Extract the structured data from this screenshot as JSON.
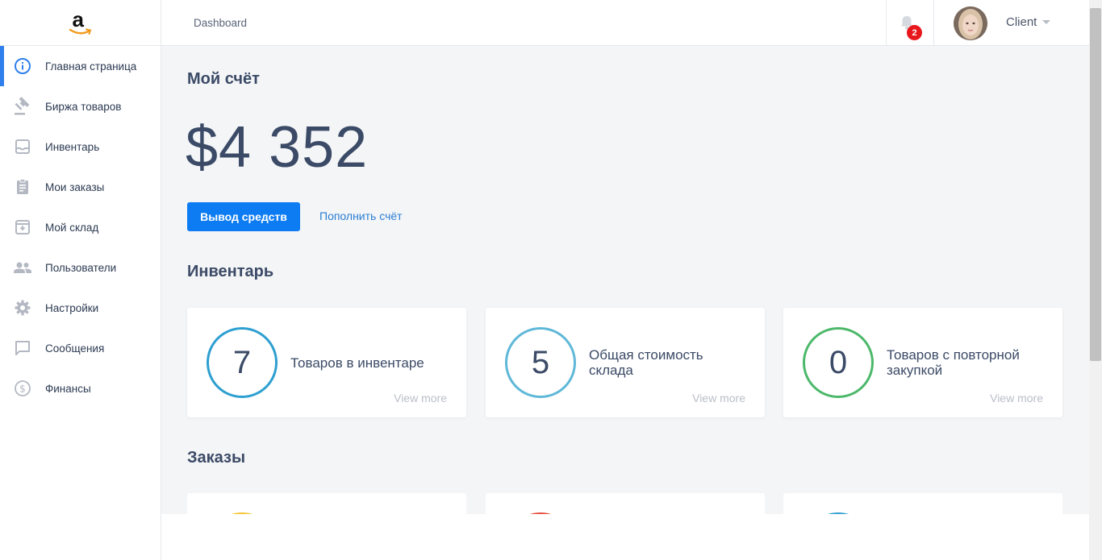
{
  "colors": {
    "accent": "#0d7cf2",
    "active_indicator": "#2f80ed",
    "badge": "#e8171c",
    "circle_blue": "#2d9fd0",
    "circle_light_blue": "#5fb8d8",
    "circle_green": "#4cb86a",
    "peek_yellow": "#f4c430",
    "peek_red": "#e74c3c",
    "peek_blue": "#2d9fd0"
  },
  "sidebar": {
    "logo_letter": "a",
    "items": [
      {
        "label": "Главная страница",
        "icon": "info-icon",
        "active": true
      },
      {
        "label": "Биржа товаров",
        "icon": "gavel-icon",
        "active": false
      },
      {
        "label": "Инвентарь",
        "icon": "inbox-icon",
        "active": false
      },
      {
        "label": "Мои заказы",
        "icon": "clipboard-icon",
        "active": false
      },
      {
        "label": "Мой склад",
        "icon": "archive-icon",
        "active": false
      },
      {
        "label": "Пользователи",
        "icon": "people-icon",
        "active": false
      },
      {
        "label": "Настройки",
        "icon": "gear-icon",
        "active": false
      },
      {
        "label": "Сообщения",
        "icon": "chat-icon",
        "active": false
      },
      {
        "label": "Финансы",
        "icon": "dollar-icon",
        "active": false
      }
    ]
  },
  "header": {
    "breadcrumb": "Dashboard",
    "notifications_count": "2",
    "user_name": "Client"
  },
  "account": {
    "title": "Мой счёт",
    "balance": "$4 352",
    "withdraw_label": "Вывод средств",
    "topup_label": "Пополнить счёт"
  },
  "inventory": {
    "title": "Инвентарь",
    "cards": [
      {
        "value": "7",
        "label": "Товаров в инвентаре",
        "link": "View more"
      },
      {
        "value": "5",
        "label": "Общая стоимость склада",
        "link": "View more"
      },
      {
        "value": "0",
        "label": "Товаров с повторной закупкой",
        "link": "View more"
      }
    ]
  },
  "orders": {
    "title": "Заказы"
  }
}
